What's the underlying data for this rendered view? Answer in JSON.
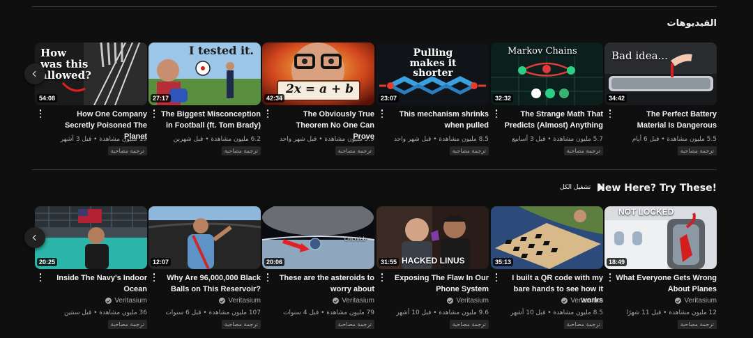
{
  "shelf1": {
    "title": "الفيديوهات",
    "videos": [
      {
        "title": "How One Company Secretly Poisoned The Planet",
        "duration": "54:08",
        "meta": "19 مليون مشاهدة • قبل 3 أشهر",
        "badge": "ترجمة مصاحبة",
        "thumb_text": "How was this allowed?"
      },
      {
        "title": "The Biggest Misconception in Football (ft. Tom Brady)",
        "duration": "27:17",
        "meta": "6.2 مليون مشاهدة • قبل شهرين",
        "badge": "ترجمة مصاحبة",
        "thumb_text": "I tested it."
      },
      {
        "title": "The Obviously True Theorem No One Can Prove",
        "duration": "42:34",
        "meta": "5.9 مليون مشاهدة • قبل شهر واحد",
        "badge": "ترجمة مصاحبة",
        "thumb_text": "2x = a + b"
      },
      {
        "title": "This mechanism shrinks when pulled",
        "duration": "23:07",
        "meta": "8.5 مليون مشاهدة • قبل شهر واحد",
        "badge": "ترجمة مصاحبة",
        "thumb_text": "Pulling makes it shorter"
      },
      {
        "title": "The Strange Math That Predicts (Almost) Anything",
        "duration": "32:32",
        "meta": "5.7 مليون مشاهدة • قبل 3 أسابيع",
        "badge": "ترجمة مصاحبة",
        "thumb_text": "Markov Chains"
      },
      {
        "title": "The Perfect Battery Material Is Dangerous",
        "duration": "34:42",
        "meta": "5.5 مليون مشاهدة • قبل 6 أيام",
        "badge": "ترجمة مصاحبة",
        "thumb_text": "Bad idea..."
      }
    ]
  },
  "shelf2": {
    "title": "New Here? Try These!",
    "play_all": "تشغيل الكل",
    "videos": [
      {
        "title": "Inside The Navy's Indoor Ocean",
        "duration": "20:25",
        "channel": "Veritasium",
        "meta": "36 مليون مشاهدة • قبل سنتين",
        "badge": "ترجمة مصاحبة",
        "thumb_text": ""
      },
      {
        "title": "Why Are 96,000,000 Black Balls on This Reservoir?",
        "duration": "12:07",
        "channel": "Veritasium",
        "meta": "107 مليون مشاهدة • قبل 6 سنوات",
        "badge": "ترجمة مصاحبة",
        "thumb_text": ""
      },
      {
        "title": "These are the asteroids to worry about",
        "duration": "20:06",
        "channel": "Veritasium",
        "meta": "79 مليون مشاهدة • قبل 4 سنوات",
        "badge": "ترجمة مصاحبة",
        "thumb_text": "Chicxulub"
      },
      {
        "title": "Exposing The Flaw In Our Phone System",
        "duration": "31:55",
        "channel": "Veritasium",
        "meta": "9.6 مليون مشاهدة • قبل 10 أشهر",
        "badge": "ترجمة مصاحبة",
        "thumb_text": "HACKED LINUS"
      },
      {
        "title": "I built a QR code with my bare hands to see how it works",
        "duration": "35:13",
        "channel": "Veritasium",
        "meta": "8.5 مليون مشاهدة • قبل 10 أشهر",
        "badge": "ترجمة مصاحبة",
        "thumb_text": ""
      },
      {
        "title": "What Everyone Gets Wrong About Planes",
        "duration": "18:49",
        "channel": "Veritasium",
        "meta": "12 مليون مشاهدة • قبل 11 شهرًا",
        "badge": "ترجمة مصاحبة",
        "thumb_text": "NOT LOCKED"
      }
    ]
  },
  "colors": {
    "background": "#0f0f0f",
    "text": "#f1f1f1",
    "secondary": "#aaaaaa",
    "badge_bg": "#272727"
  }
}
